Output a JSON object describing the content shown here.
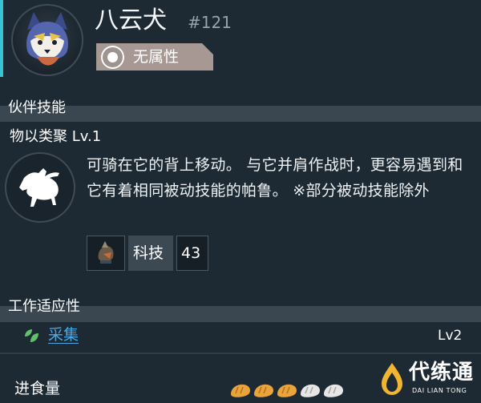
{
  "pal": {
    "name": "八云犬",
    "number": "#121",
    "element": {
      "label": "无属性",
      "icon": "neutral-element-icon"
    },
    "portrait_icon": "direhowl-portrait"
  },
  "partner_skill": {
    "section_title": "伙伴技能",
    "name": "物以类聚 Lv.1",
    "icon": "horse-rider-icon",
    "description": "可骑在它的背上移动。 与它并肩作战时，更容易遇到和它有着相同被动技能的帕鲁。 ※部分被动技能除外",
    "tech": {
      "item_icon": "saddle-item-icon",
      "label": "科技",
      "value": "43"
    }
  },
  "work_suitability": {
    "section_title": "工作适应性",
    "items": [
      {
        "label": "采集",
        "icon": "leaf-icon",
        "level": "Lv2",
        "accent": "#49a9e8"
      }
    ]
  },
  "food": {
    "label": "进食量",
    "filled": 3,
    "total": 5,
    "icons": "bread-icon"
  },
  "watermark": {
    "cn": "代练通",
    "en": "DAI LIAN TONG"
  },
  "colors": {
    "background": "#1d2a33",
    "section_bar": "#3a4750",
    "element_tag": "#a79893",
    "link_blue": "#49a9e8",
    "cyan_accent": "#39c3cf",
    "food_filled": "#e9a53c",
    "food_empty": "#e6e6e6"
  }
}
